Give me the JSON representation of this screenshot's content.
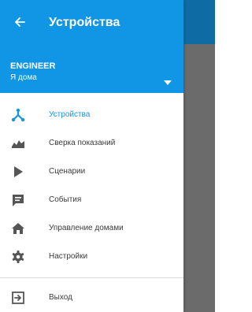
{
  "header": {
    "title": "Устройства",
    "back_icon": "arrow-left-icon"
  },
  "account": {
    "name": "ENGINEER",
    "location": "Я дома"
  },
  "menu": {
    "items": [
      {
        "label": "Устройства",
        "icon": "devices-tree-icon",
        "active": true
      },
      {
        "label": "Сверка показаний",
        "icon": "readings-icon",
        "active": false
      },
      {
        "label": "Сценарии",
        "icon": "play-icon",
        "active": false
      },
      {
        "label": "События",
        "icon": "message-icon",
        "active": false
      },
      {
        "label": "Управление домами",
        "icon": "home-icon",
        "active": false
      },
      {
        "label": "Настройки",
        "icon": "gear-icon",
        "active": false
      }
    ],
    "exit": {
      "label": "Выход",
      "icon": "exit-icon"
    }
  },
  "colors": {
    "primary": "#1196e6",
    "backdrop": "#6b6b6b",
    "icon": "#555555",
    "text": "#3a3a3a"
  }
}
